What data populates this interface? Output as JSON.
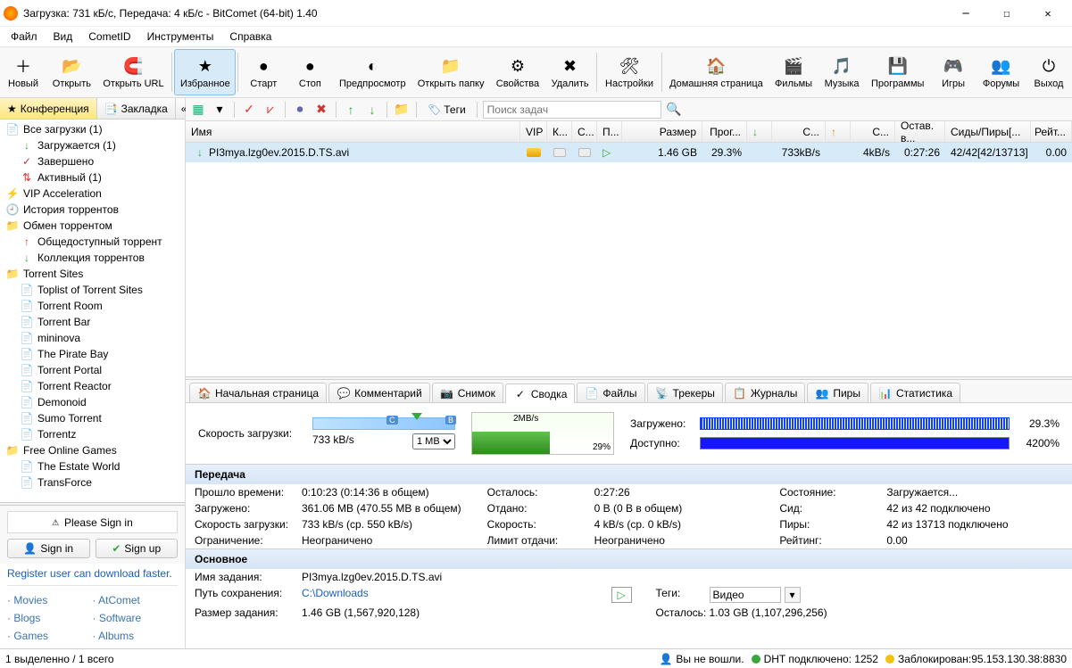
{
  "window": {
    "title": "Загрузка: 731 кБ/с, Передача: 4 кБ/с - BitComet (64-bit) 1.40"
  },
  "menu": [
    "Файл",
    "Вид",
    "CometID",
    "Инструменты",
    "Справка"
  ],
  "toolbar": [
    {
      "label": "Новый",
      "icon": "＋",
      "name": "tb-new"
    },
    {
      "label": "Открыть",
      "icon": "📂",
      "name": "tb-open"
    },
    {
      "label": "Открыть URL",
      "icon": "🧲",
      "name": "tb-open-url"
    },
    {
      "label": "Избранное",
      "icon": "★",
      "name": "tb-favorites",
      "selected": true
    },
    {
      "label": "Старт",
      "icon": "●",
      "name": "tb-start"
    },
    {
      "label": "Стоп",
      "icon": "●",
      "name": "tb-stop"
    },
    {
      "label": "Предпросмотр",
      "icon": "◐",
      "name": "tb-preview"
    },
    {
      "label": "Открыть папку",
      "icon": "📁",
      "name": "tb-open-folder"
    },
    {
      "label": "Свойства",
      "icon": "⚙",
      "name": "tb-properties"
    },
    {
      "label": "Удалить",
      "icon": "✖",
      "name": "tb-delete"
    },
    {
      "label": "Настройки",
      "icon": "🛠",
      "name": "tb-settings"
    },
    {
      "label": "Домашняя страница",
      "icon": "🏠",
      "name": "tb-home"
    },
    {
      "label": "Фильмы",
      "icon": "🎬",
      "name": "tb-movies"
    },
    {
      "label": "Музыка",
      "icon": "🎵",
      "name": "tb-music"
    },
    {
      "label": "Программы",
      "icon": "💾",
      "name": "tb-software"
    },
    {
      "label": "Игры",
      "icon": "🎮",
      "name": "tb-games"
    },
    {
      "label": "Форумы",
      "icon": "👥",
      "name": "tb-forums"
    },
    {
      "label": "Выход",
      "icon": "⏻",
      "name": "tb-exit"
    }
  ],
  "side_tabs": {
    "conference": "Конференция",
    "bookmark": "Закладка"
  },
  "tree": [
    {
      "label": "Все загрузки (1)",
      "lvl": 1,
      "ico": "📄"
    },
    {
      "label": "Загружается (1)",
      "lvl": 2,
      "ico": "↓",
      "c": "#37A93C"
    },
    {
      "label": "Завершено",
      "lvl": 2,
      "ico": "✓",
      "c": "#d33"
    },
    {
      "label": "Активный (1)",
      "lvl": 2,
      "ico": "⇅",
      "c": "#d33"
    },
    {
      "label": "VIP Acceleration",
      "lvl": 1,
      "ico": "⚡",
      "c": "#c90"
    },
    {
      "label": "История торрентов",
      "lvl": 1,
      "ico": "🕘"
    },
    {
      "label": "Обмен торрентом",
      "lvl": 1,
      "ico": "📁",
      "c": "#ffcc33"
    },
    {
      "label": "Общедоступный торрент",
      "lvl": 2,
      "ico": "↑",
      "c": "#d33"
    },
    {
      "label": "Коллекция торрентов",
      "lvl": 2,
      "ico": "↓",
      "c": "#37A93C"
    },
    {
      "label": "Torrent Sites",
      "lvl": 1,
      "ico": "📁",
      "c": "#ffcc33"
    },
    {
      "label": "Toplist of Torrent Sites",
      "lvl": 2,
      "ico": "📄",
      "c": "#f5c242"
    },
    {
      "label": "Torrent Room",
      "lvl": 2,
      "ico": "📄",
      "c": "#f5c242"
    },
    {
      "label": "Torrent Bar",
      "lvl": 2,
      "ico": "📄",
      "c": "#f5c242"
    },
    {
      "label": "mininova",
      "lvl": 2,
      "ico": "📄",
      "c": "#f5c242"
    },
    {
      "label": "The Pirate Bay",
      "lvl": 2,
      "ico": "📄",
      "c": "#f5c242"
    },
    {
      "label": "Torrent Portal",
      "lvl": 2,
      "ico": "📄",
      "c": "#f5c242"
    },
    {
      "label": "Torrent Reactor",
      "lvl": 2,
      "ico": "📄",
      "c": "#f5c242"
    },
    {
      "label": "Demonoid",
      "lvl": 2,
      "ico": "📄",
      "c": "#f5c242"
    },
    {
      "label": "Sumo Torrent",
      "lvl": 2,
      "ico": "📄",
      "c": "#f5c242"
    },
    {
      "label": "Torrentz",
      "lvl": 2,
      "ico": "📄",
      "c": "#f5c242"
    },
    {
      "label": "Free Online Games",
      "lvl": 1,
      "ico": "📁",
      "c": "#ffcc33"
    },
    {
      "label": "The Estate World",
      "lvl": 2,
      "ico": "📄",
      "c": "#f5c242"
    },
    {
      "label": "TransForce",
      "lvl": 2,
      "ico": "📄",
      "c": "#f5c242"
    }
  ],
  "login": {
    "please": "Please Sign in",
    "signin": "Sign in",
    "signup": "Sign up",
    "register": "Register user can download faster."
  },
  "links": [
    "Movies",
    "AtComet",
    "Blogs",
    "Software",
    "Games",
    "Albums"
  ],
  "subtool": {
    "tags": "Теги",
    "search": "Поиск задач"
  },
  "columns": {
    "name": "Имя",
    "vip": "VIP",
    "k": "К...",
    "s": "С...",
    "p": "П...",
    "size": "Размер",
    "prog": "Прог...",
    "dlv": "С...",
    "ulv": "С...",
    "eta": "Остав. в...",
    "seeds": "Сиды/Пиры[...",
    "rate": "Рейт..."
  },
  "row": {
    "name": "PI3mya.lzg0ev.2015.D.TS.avi",
    "size": "1.46 GB",
    "prog": "29.3%",
    "dl": "733kB/s",
    "ul": "4kB/s",
    "eta": "0:27:26",
    "seeds": "42/42[42/13713]",
    "rate": "0.00"
  },
  "dtabs": [
    "Начальная страница",
    "Комментарий",
    "Снимок",
    "Сводка",
    "Файлы",
    "Трекеры",
    "Журналы",
    "Пиры",
    "Статистика"
  ],
  "summary": {
    "speed_label": "Скорость загрузки:",
    "speed": "733 kB/s",
    "limit": "1 MB",
    "chart_top": "2MB/s",
    "chart_pct": "29%",
    "loaded_label": "Загружено:",
    "loaded_pct": "29.3%",
    "avail_label": "Доступно:",
    "avail_pct": "4200%"
  },
  "transfer": {
    "header": "Передача",
    "elapsed_k": "Прошло времени:",
    "elapsed_v": "0:10:23 (0:14:36 в общем)",
    "remain_k": "Осталось:",
    "remain_v": "0:27:26",
    "state_k": "Состояние:",
    "state_v": "Загружается...",
    "down_k": "Загружено:",
    "down_v": "361.06 MB (470.55 MB в общем)",
    "given_k": "Отдано:",
    "given_v": "0 B (0 B в общем)",
    "seed_k": "Сид:",
    "seed_v": "42 из 42 подключено",
    "dls_k": "Скорость загрузки:",
    "dls_v": "733 kB/s (ср. 550 kB/s)",
    "uls_k": "Скорость:",
    "uls_v": "4 kB/s (ср. 0 kB/s)",
    "peer_k": "Пиры:",
    "peer_v": "42 из 13713 подключено",
    "lim_k": "Ограничение:",
    "lim_v": "Неограничено",
    "limg_k": "Лимит отдачи:",
    "limg_v": "Неограничено",
    "rate_k": "Рейтинг:",
    "rate_v": "0.00"
  },
  "general": {
    "header": "Основное",
    "name_k": "Имя задания:",
    "name_v": "PI3mya.lzg0ev.2015.D.TS.avi",
    "path_k": "Путь сохранения:",
    "path_v": "C:\\Downloads",
    "tags_k": "Теги:",
    "tags_v": "Видео",
    "size_k": "Размер задания:",
    "size_v": "1.46 GB (1,567,920,128)",
    "remain_k": "Осталось:",
    "remain_v": "1.03 GB (1,107,296,256)"
  },
  "status": {
    "sel": "1 выделенно / 1 всего",
    "offline": "Вы не вошли.",
    "dht": "DHT подключено: 1252",
    "blocked": "Заблокирован:95.153.130.38:8830"
  }
}
